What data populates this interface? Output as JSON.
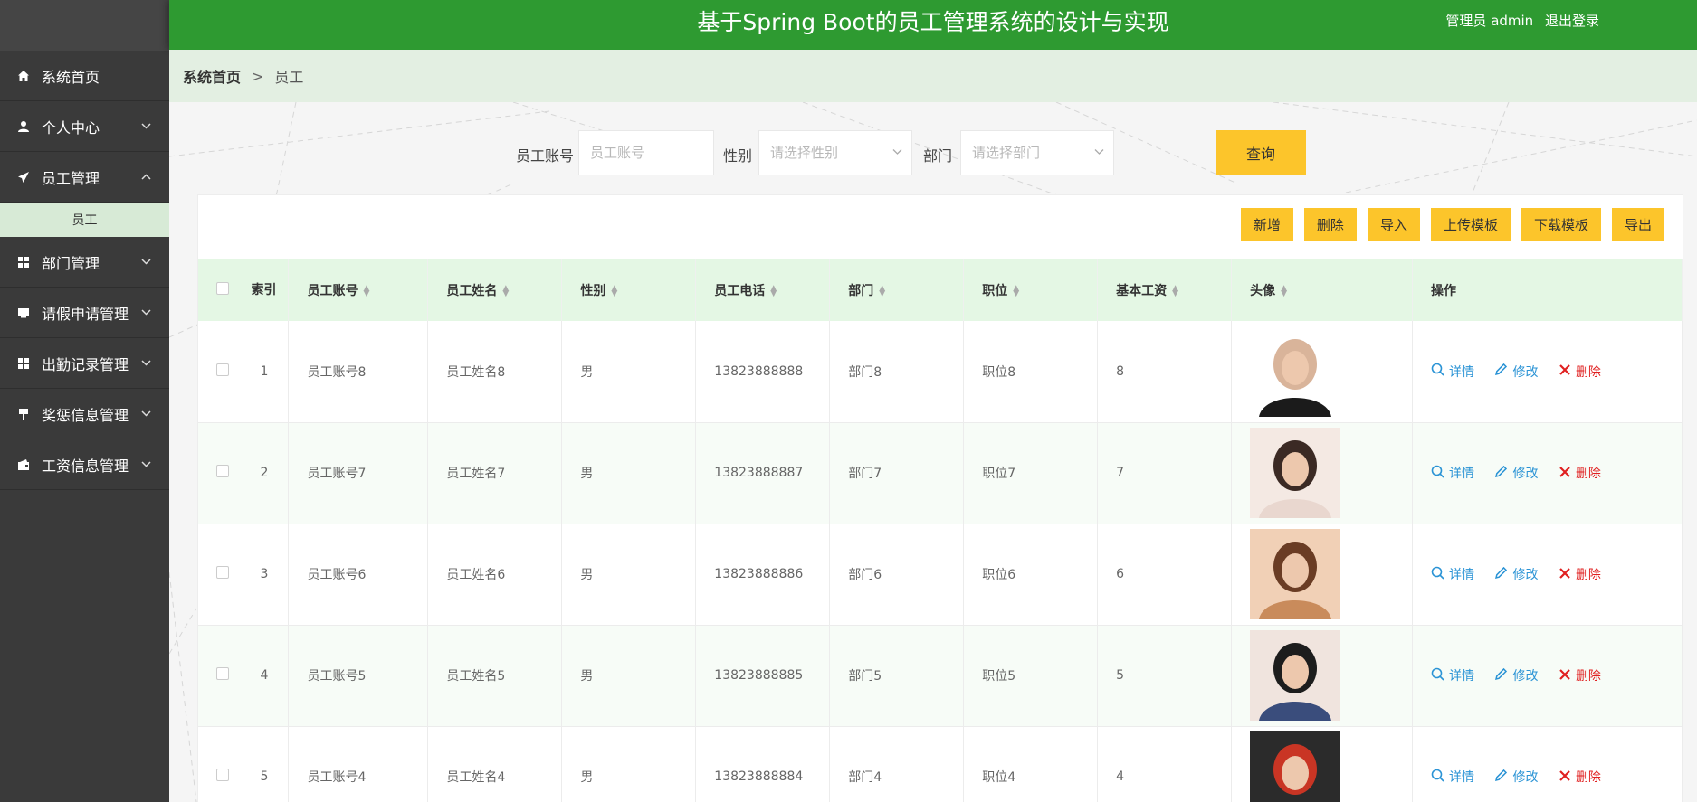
{
  "app": {
    "title": "基于Spring Boot的员工管理系统的设计与实现",
    "user_label": "管理员 admin",
    "logout_label": "退出登录"
  },
  "sidebar": {
    "items": [
      {
        "label": "系统首页",
        "icon": "home-icon"
      },
      {
        "label": "个人中心",
        "icon": "user-icon"
      },
      {
        "label": "员工管理",
        "icon": "send-icon"
      },
      {
        "label": "部门管理",
        "icon": "grid-icon"
      },
      {
        "label": "请假申请管理",
        "icon": "monitor-icon"
      },
      {
        "label": "出勤记录管理",
        "icon": "grid-icon"
      },
      {
        "label": "奖惩信息管理",
        "icon": "pin-icon"
      },
      {
        "label": "工资信息管理",
        "icon": "wallet-icon"
      }
    ],
    "sub_item": "员工"
  },
  "breadcrumb": {
    "home": "系统首页",
    "separator": ">",
    "current": "员工"
  },
  "search": {
    "account_label": "员工账号",
    "account_placeholder": "员工账号",
    "gender_label": "性别",
    "gender_placeholder": "请选择性别",
    "dept_label": "部门",
    "dept_placeholder": "请选择部门",
    "query_label": "查询"
  },
  "toolbar": {
    "add": "新增",
    "delete": "删除",
    "import": "导入",
    "upload_template": "上传模板",
    "download_template": "下载模板",
    "export": "导出"
  },
  "table": {
    "headers": {
      "index": "索引",
      "account": "员工账号",
      "name": "员工姓名",
      "gender": "性别",
      "phone": "员工电话",
      "dept": "部门",
      "position": "职位",
      "salary": "基本工资",
      "avatar": "头像",
      "ops": "操作"
    },
    "rows": [
      {
        "index": "1",
        "account": "员工账号8",
        "name": "员工姓名8",
        "gender": "男",
        "phone": "13823888888",
        "dept": "部门8",
        "position": "职位8",
        "salary": "8"
      },
      {
        "index": "2",
        "account": "员工账号7",
        "name": "员工姓名7",
        "gender": "男",
        "phone": "13823888887",
        "dept": "部门7",
        "position": "职位7",
        "salary": "7"
      },
      {
        "index": "3",
        "account": "员工账号6",
        "name": "员工姓名6",
        "gender": "男",
        "phone": "13823888886",
        "dept": "部门6",
        "position": "职位6",
        "salary": "6"
      },
      {
        "index": "4",
        "account": "员工账号5",
        "name": "员工姓名5",
        "gender": "男",
        "phone": "13823888885",
        "dept": "部门5",
        "position": "职位5",
        "salary": "5"
      },
      {
        "index": "5",
        "account": "员工账号4",
        "name": "员工姓名4",
        "gender": "男",
        "phone": "13823888884",
        "dept": "部门4",
        "position": "职位4",
        "salary": "4"
      }
    ],
    "ops": {
      "detail": "详情",
      "edit": "修改",
      "delete": "删除"
    }
  },
  "colors": {
    "header_green": "#2e9a31",
    "sidebar_dark": "#3a3a3a",
    "button_yellow": "#fcc52b",
    "link_blue": "#2a93d5",
    "delete_red": "#e02020"
  }
}
